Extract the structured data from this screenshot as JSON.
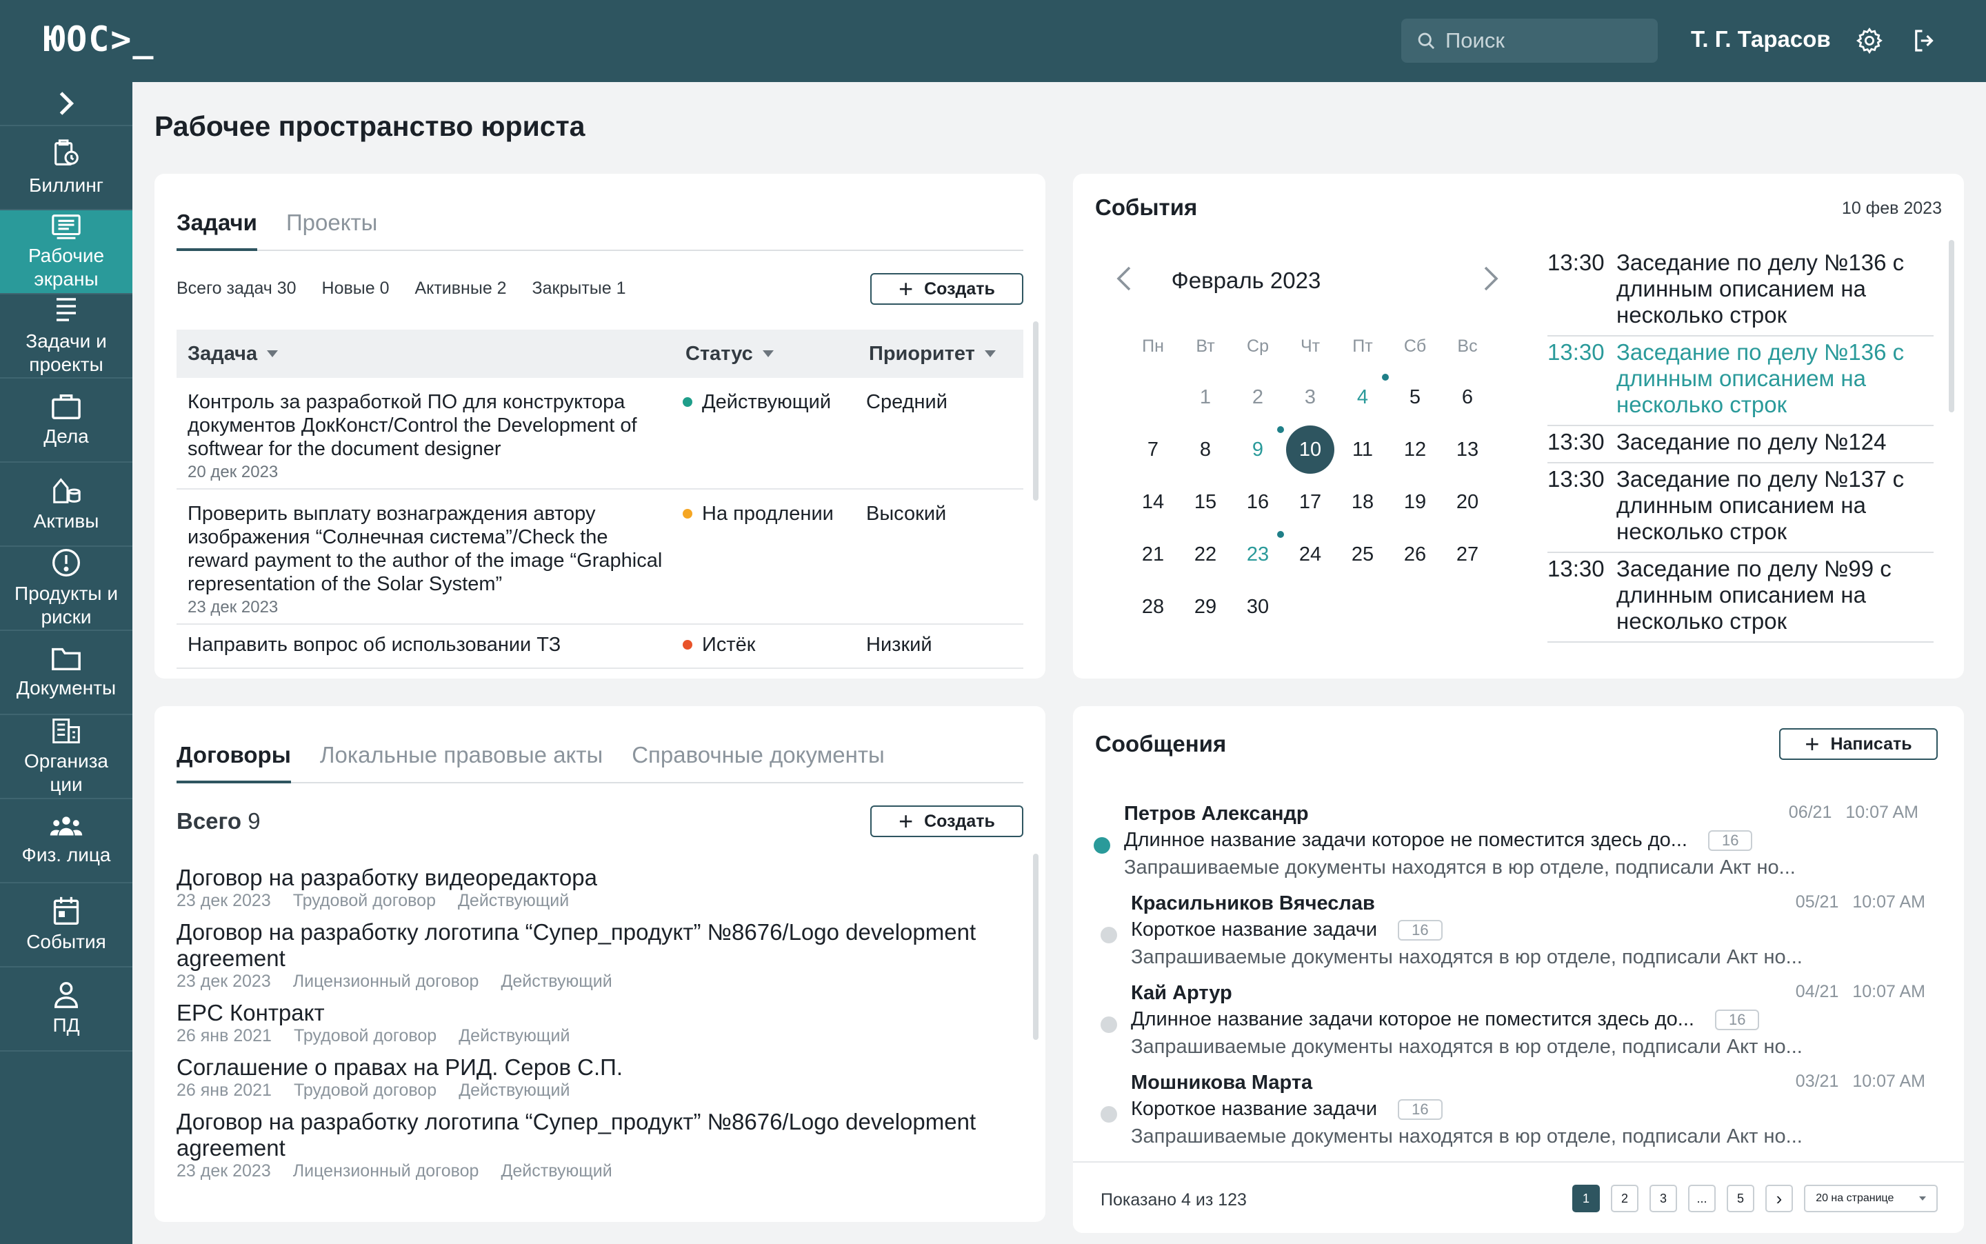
{
  "app": {
    "logo": "ЮОС>_"
  },
  "header": {
    "search_placeholder": "Поиск",
    "user": "Т. Г. Тарасов"
  },
  "sidebar": {
    "items": [
      {
        "label": "Биллинг"
      },
      {
        "label": "Рабочие экраны"
      },
      {
        "label": "Задачи и проекты"
      },
      {
        "label": "Дела"
      },
      {
        "label": "Активы"
      },
      {
        "label": "Продукты и риски"
      },
      {
        "label": "Документы"
      },
      {
        "label": "Организа ции"
      },
      {
        "label": "Физ. лица"
      },
      {
        "label": "События"
      },
      {
        "label": "ПД"
      }
    ]
  },
  "page": {
    "title": "Рабочее пространство юриста"
  },
  "tasks": {
    "tabs": [
      "Задачи",
      "Проекты"
    ],
    "counts": {
      "total": "Всего задач 30",
      "new": "Новые 0",
      "active": "Активные 2",
      "closed": "Закрытые 1"
    },
    "create_label": "Создать",
    "columns": [
      "Задача",
      "Статус",
      "Приоритет"
    ],
    "rows": [
      {
        "task": "Контроль за разработкой ПО для конструктора документов ДокКонст/Control the Development of softwear for the document designer",
        "date": "20 дек 2023",
        "status": "Действующий",
        "status_color": "#1f9e8a",
        "priority": "Средний"
      },
      {
        "task": "Проверить выплату вознаграждения автору изображения “Солнечная система”/Check the reward payment to the author of the image “Graphical representation of the Solar System”",
        "date": "23 дек 2023",
        "status": "На продлении",
        "status_color": "#f5a623",
        "priority": "Высокий"
      },
      {
        "task": "Направить вопрос об использовании ТЗ",
        "date": "",
        "status": "Истёк",
        "status_color": "#e8532a",
        "priority": "Низкий"
      }
    ]
  },
  "docs": {
    "tabs": [
      "Договоры",
      "Локальные правовые акты",
      "Справочные документы"
    ],
    "total_label": "Всего",
    "total_value": "9",
    "create_label": "Создать",
    "items": [
      {
        "title": "Договор на разработку видеоредактора",
        "date": "23 дек 2023",
        "type": "Трудовой договор",
        "status": "Действующий"
      },
      {
        "title": "Договор на разработку логотипа “Супер_продукт” №8676/Logo development agreement",
        "date": "23 дек 2023",
        "type": "Лицензионный договор",
        "status": "Действующий"
      },
      {
        "title": "EPC Контракт",
        "date": "26 янв 2021",
        "type": "Трудовой договор",
        "status": "Действующий"
      },
      {
        "title": "Соглашение о правах на РИД. Серов С.П.",
        "date": "26 янв 2021",
        "type": "Трудовой договор",
        "status": "Действующий"
      },
      {
        "title": "Договор на разработку логотипа “Супер_продукт” №8676/Logo development agreement",
        "date": "23 дек 2023",
        "type": "Лицензионный договор",
        "status": "Действующий"
      }
    ]
  },
  "events": {
    "title": "События",
    "date": "10 фев 2023",
    "month": "Февраль 2023",
    "weekdays": [
      "Пн",
      "Вт",
      "Ср",
      "Чт",
      "Пт",
      "Сб",
      "Вс"
    ],
    "selected_day": 10,
    "list": [
      {
        "time": "13:30",
        "text": "Заседание по делу №136 с длинным описанием на несколько строк",
        "highlight": false
      },
      {
        "time": "13:30",
        "text": "Заседание по делу №136 с длинным описанием на несколько строк",
        "highlight": true
      },
      {
        "time": "13:30",
        "text": "Заседание по делу №124",
        "highlight": false
      },
      {
        "time": "13:30",
        "text": "Заседание по делу №137 с длинным описанием на несколько строк",
        "highlight": false
      },
      {
        "time": "13:30",
        "text": "Заседание по делу №99 с длинным описанием на несколько строк",
        "highlight": false
      }
    ]
  },
  "messages": {
    "title": "Сообщения",
    "write_label": "Написать",
    "items": [
      {
        "name": "Петров Александр",
        "date": "06/21",
        "time": "10:07 AM",
        "subject": "Длинное название задачи которое не поместится здесь до...",
        "badge": "16",
        "preview": "Запрашиваемые документы находятся в юр отделе, подписали Акт но...",
        "unread": true
      },
      {
        "name": "Красильников Вячеслав",
        "date": "05/21",
        "time": "10:07 AM",
        "subject": "Короткое название задачи",
        "badge": "16",
        "preview": "Запрашиваемые документы находятся в юр отделе, подписали Акт но...",
        "unread": false
      },
      {
        "name": "Кай Артур",
        "date": "04/21",
        "time": "10:07 AM",
        "subject": "Длинное название задачи которое не поместится здесь до...",
        "badge": "16",
        "preview": "Запрашиваемые документы находятся в юр отделе, подписали Акт но...",
        "unread": false
      },
      {
        "name": "Мошникова Марта",
        "date": "03/21",
        "time": "10:07 AM",
        "subject": "Короткое название задачи",
        "badge": "16",
        "preview": "Запрашиваемые документы находятся в юр отделе, подписали Акт но...",
        "unread": false
      }
    ],
    "footer": {
      "shown": "Показано 4 из 123",
      "pages": [
        "1",
        "2",
        "3",
        "...",
        "5"
      ],
      "next": "›",
      "per_page": "20 на странице"
    }
  },
  "colors": {
    "primary": "#2e5560",
    "accent": "#2a9a9a"
  }
}
